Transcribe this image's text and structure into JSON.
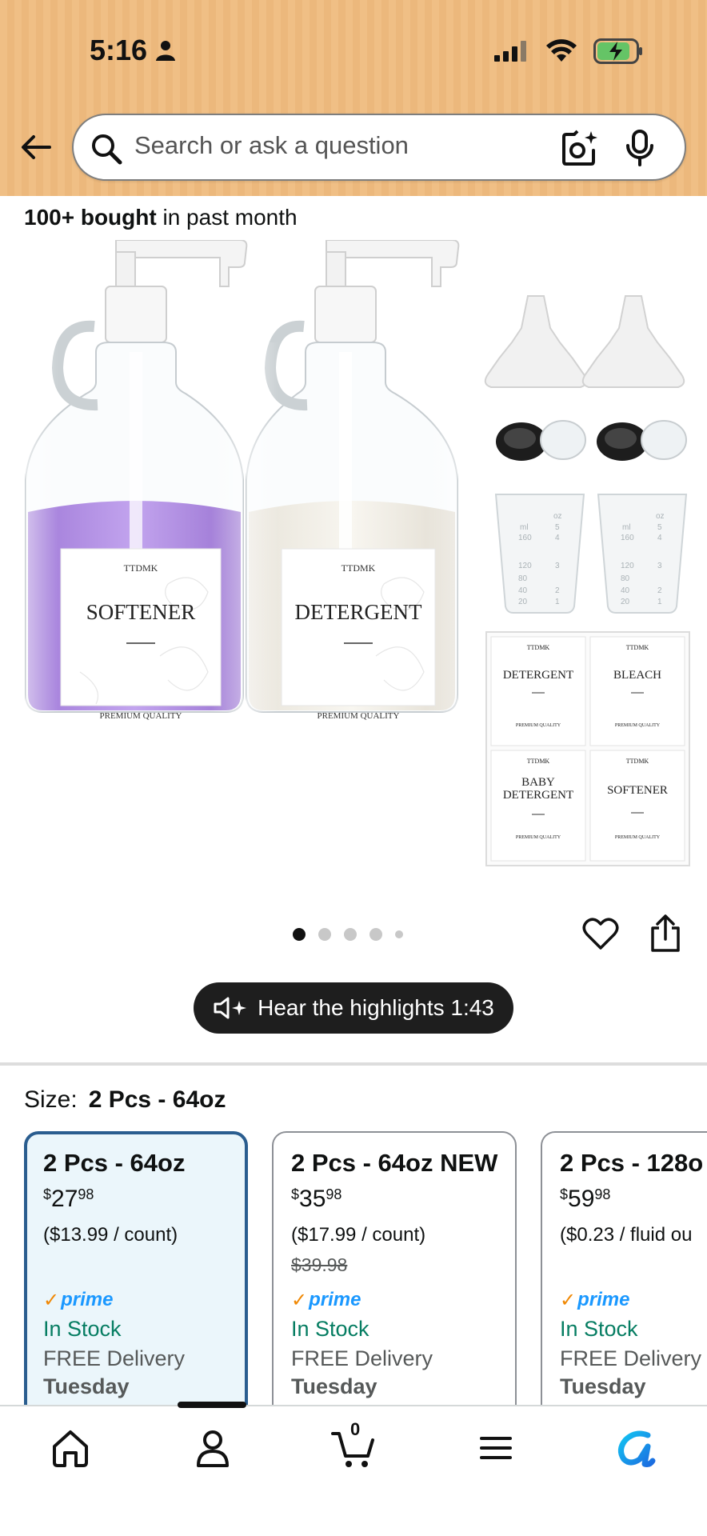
{
  "status_bar": {
    "time": "5:16"
  },
  "search": {
    "placeholder": "Search or ask a question"
  },
  "bought": {
    "bold": "100+ bought",
    "rest": " in past month"
  },
  "product_image": {
    "bottle_left": {
      "brand": "TTDMK",
      "name": "SOFTENER",
      "tagline": "PREMIUM QUALITY"
    },
    "bottle_right": {
      "brand": "TTDMK",
      "name": "DETERGENT",
      "tagline": "PREMIUM QUALITY"
    },
    "cup_marks_left": [
      "ml",
      "160",
      "120",
      "80",
      "40",
      "20"
    ],
    "cup_marks_right": [
      "oz",
      "5",
      "4",
      "3",
      "2",
      "1"
    ],
    "stickers": [
      {
        "brand": "TTDMK",
        "name": "DETERGENT",
        "tagline": "PREMIUM QUALITY"
      },
      {
        "brand": "TTDMK",
        "name": "BLEACH",
        "tagline": "PREMIUM QUALITY"
      },
      {
        "brand": "TTDMK",
        "name_line1": "BABY",
        "name_line2": "DETERGENT",
        "tagline": "PREMIUM QUALITY"
      },
      {
        "brand": "TTDMK",
        "name": "SOFTENER",
        "tagline": "PREMIUM QUALITY"
      }
    ],
    "carousel_total": 5,
    "carousel_active": 1
  },
  "hear_highlights": {
    "label": "Hear the highlights 1:43"
  },
  "size": {
    "label": "Size:",
    "value": "2 Pcs - 64oz"
  },
  "size_options": [
    {
      "title": "2 Pcs - 64oz",
      "currency": "$",
      "whole": "27",
      "fraction": "98",
      "unit_price": "($13.99 / count)",
      "list_price": "",
      "prime": "prime",
      "stock": "In Stock",
      "delivery": "FREE Delivery",
      "day": "Tuesday",
      "selected": true
    },
    {
      "title": "2 Pcs - 64oz NEW",
      "currency": "$",
      "whole": "35",
      "fraction": "98",
      "unit_price": "($17.99 / count)",
      "list_price": "$39.98",
      "prime": "prime",
      "stock": "In Stock",
      "delivery": "FREE Delivery",
      "day": "Tuesday",
      "selected": false
    },
    {
      "title": "2 Pcs - 128o",
      "currency": "$",
      "whole": "59",
      "fraction": "98",
      "unit_price": "($0.23 / fluid ou",
      "list_price": "",
      "prime": "prime",
      "stock": "In Stock",
      "delivery": "FREE Delivery",
      "day": "Tuesday",
      "selected": false
    }
  ],
  "bottom_nav": {
    "cart_count": "0",
    "items": [
      "home-icon",
      "account-icon",
      "cart-icon",
      "menu-icon",
      "rufus-icon"
    ]
  },
  "colors": {
    "header": "#f0bf85",
    "selected_border": "#2a5d8f",
    "selected_bg": "#ebf6fb",
    "in_stock": "#067d62",
    "prime_blue": "#1a98ff",
    "prime_check": "#f08804",
    "softener_purple": "#b99ae6"
  }
}
